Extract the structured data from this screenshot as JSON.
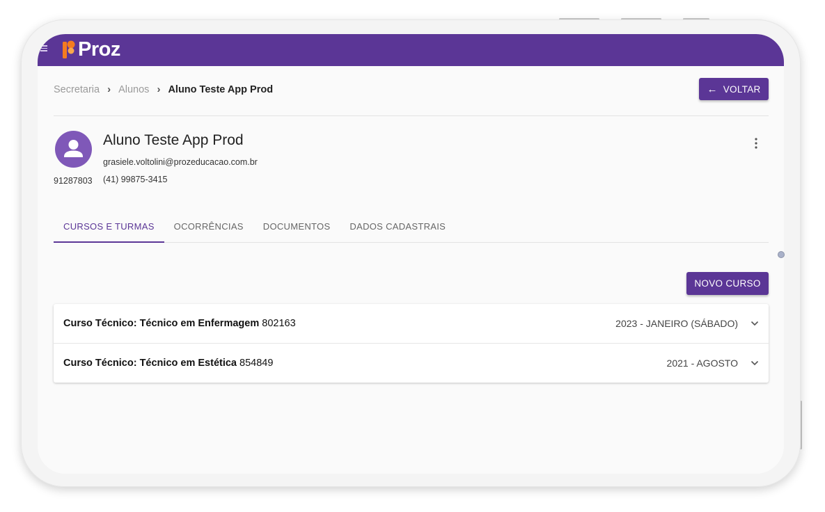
{
  "app": {
    "logo_text": "Proz",
    "brand_color": "#5b3696"
  },
  "breadcrumb": {
    "items": [
      "Secretaria",
      "Alunos"
    ],
    "current": "Aluno Teste App Prod"
  },
  "header": {
    "back_label": "VOLTAR"
  },
  "student": {
    "name": "Aluno Teste App Prod",
    "email": "grasiele.voltolini@prozeducacao.com.br",
    "id": "91287803",
    "phone": "(41) 99875-3415"
  },
  "tabs": [
    {
      "label": "CURSOS E TURMAS",
      "active": true
    },
    {
      "label": "OCORRÊNCIAS",
      "active": false
    },
    {
      "label": "DOCUMENTOS",
      "active": false
    },
    {
      "label": "DADOS CADASTRAIS",
      "active": false
    }
  ],
  "actions": {
    "new_course_label": "NOVO CURSO"
  },
  "courses": [
    {
      "title": "Curso Técnico: Técnico em Enfermagem",
      "code": "802163",
      "period": "2023 - JANEIRO (SÁBADO)"
    },
    {
      "title": "Curso Técnico: Técnico em Estética",
      "code": "854849",
      "period": "2021 - AGOSTO"
    }
  ],
  "icons": [
    "menu-icon",
    "proz-logo-icon",
    "chevron-right-icon",
    "arrow-left-icon",
    "person-icon",
    "more-vert-icon",
    "chevron-down-icon"
  ]
}
